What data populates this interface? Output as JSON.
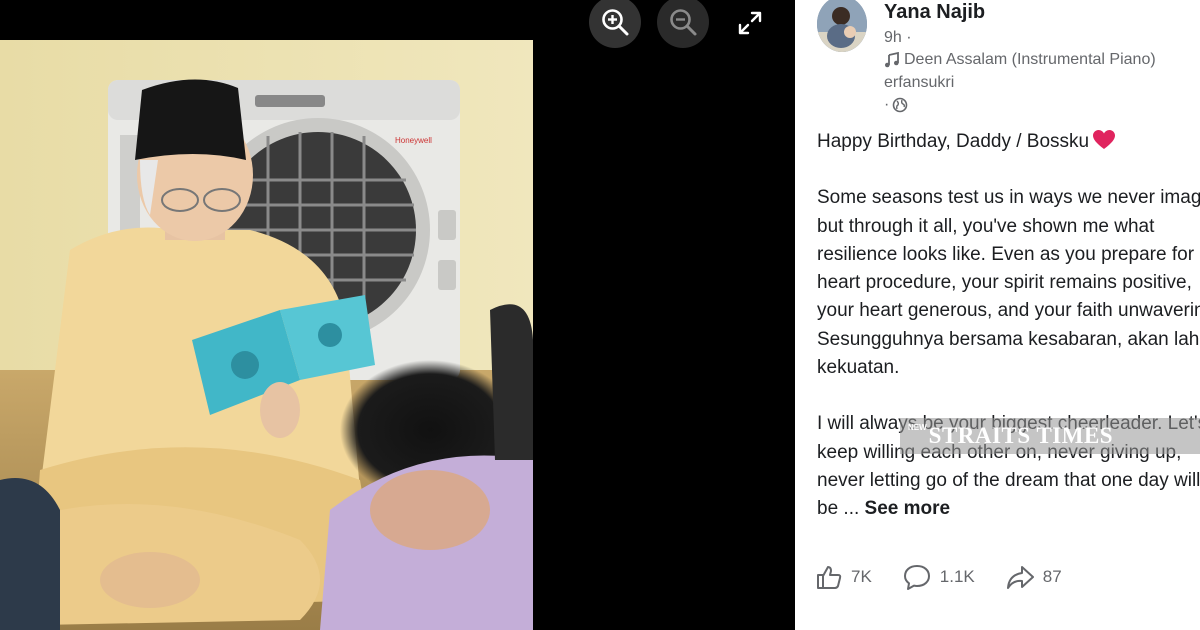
{
  "viewer": {
    "zoom_in_icon": "zoom-in-icon",
    "zoom_out_icon": "zoom-out-icon",
    "expand_icon": "fullscreen-expand-icon"
  },
  "post": {
    "author": "Yana Najib",
    "time": "9h ·",
    "music": "Deen Assalam (Instrumental Piano)",
    "music_by": "erfansukri",
    "privacy": "·",
    "lines": [
      "Happy Birthday, Daddy / Bossku",
      "",
      "Some seasons test us in ways we never imagined,",
      "but through it all, you've shown me what",
      "resilience looks like. Even as you prepare for",
      "heart procedure, your spirit remains positive,",
      "your heart generous, and your faith unwavering.",
      "Sesungguhnya bersama kesabaran, akan lahir",
      "kekuatan.",
      "",
      "I will always be your biggest cheerleader. Let's",
      "keep willing each other on, never giving up,",
      "never letting go of the dream that one day will",
      "be ..."
    ],
    "see_more": "See more"
  },
  "watermark": {
    "prefix": "NEW",
    "name": "STRAITS TIMES"
  },
  "actions": {
    "likes": "7K",
    "comments": "1.1K",
    "shares": "87"
  },
  "colors": {
    "text": "#1c1e21",
    "secondary": "#65676b",
    "heart": "#e0245e"
  }
}
